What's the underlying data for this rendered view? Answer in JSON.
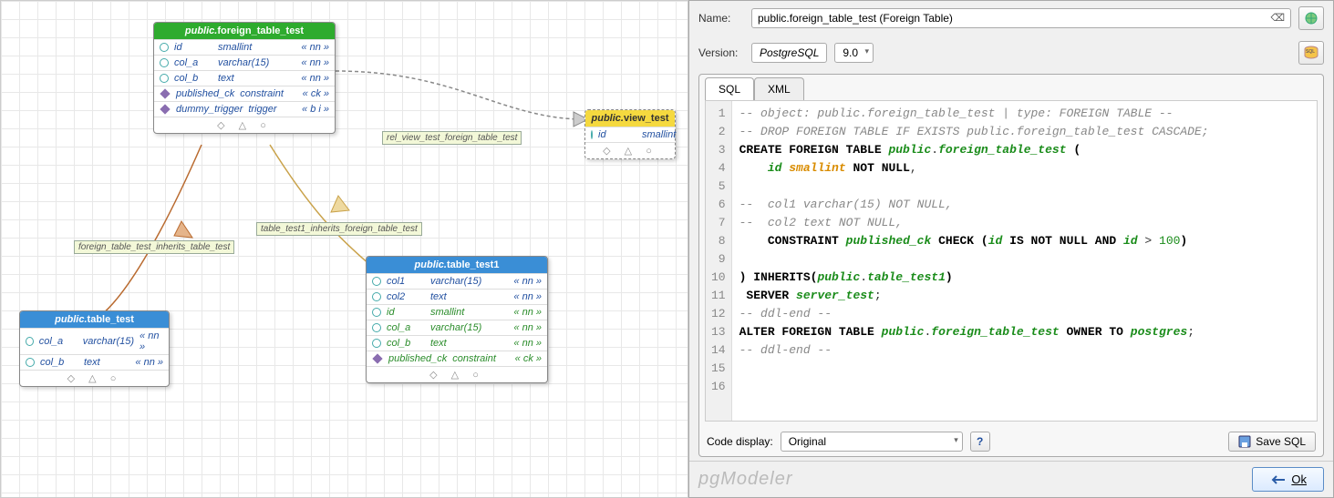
{
  "panel": {
    "name_label": "Name:",
    "name_value": "public.foreign_table_test (Foreign Table)",
    "version_label": "Version:",
    "version_engine": "PostgreSQL",
    "version_num": "9.0",
    "tabs": {
      "sql": "SQL",
      "xml": "XML"
    },
    "code_display_label": "Code display:",
    "code_display_value": "Original",
    "save_sql": "Save SQL",
    "brand": "pgModeler",
    "ok": "Ok"
  },
  "tables": {
    "foreign": {
      "title_schema": "public.",
      "title_name": "foreign_table_test",
      "rows": [
        {
          "k": "pk",
          "n": "id",
          "t": "smallint",
          "f": "« nn »"
        },
        {
          "k": "pk",
          "n": "col_a",
          "t": "varchar(15)",
          "f": "« nn »"
        },
        {
          "k": "pk",
          "n": "col_b",
          "t": "text",
          "f": "« nn »"
        },
        {
          "k": "dia",
          "n": "published_ck",
          "t": "constraint",
          "f": "« ck »"
        },
        {
          "k": "dia",
          "n": "dummy_trigger",
          "t": "trigger",
          "f": "« b i »"
        }
      ]
    },
    "view": {
      "title_schema": "public.",
      "title_name": "view_test",
      "rows": [
        {
          "k": "pk",
          "n": "id",
          "t": "smallint",
          "f": ""
        }
      ]
    },
    "test1": {
      "title_schema": "public.",
      "title_name": "table_test1",
      "rows": [
        {
          "k": "pk",
          "n": "col1",
          "t": "varchar(15)",
          "f": "« nn »"
        },
        {
          "k": "pk",
          "n": "col2",
          "t": "text",
          "f": "« nn »"
        },
        {
          "k": "pk",
          "n": "id",
          "t": "smallint",
          "f": "« nn »",
          "inh": true
        },
        {
          "k": "pk",
          "n": "col_a",
          "t": "varchar(15)",
          "f": "« nn »",
          "inh": true
        },
        {
          "k": "pk",
          "n": "col_b",
          "t": "text",
          "f": "« nn »",
          "inh": true
        },
        {
          "k": "dia",
          "n": "published_ck",
          "t": "constraint",
          "f": "« ck »",
          "inh": true
        }
      ]
    },
    "test": {
      "title_schema": "public.",
      "title_name": "table_test",
      "rows": [
        {
          "k": "pk",
          "n": "col_a",
          "t": "varchar(15)",
          "f": "« nn »"
        },
        {
          "k": "pk",
          "n": "col_b",
          "t": "text",
          "f": "« nn »"
        }
      ]
    }
  },
  "relations": {
    "r1": "rel_view_test_foreign_table_test",
    "r2": "table_test1_inherits_foreign_table_test",
    "r3": "foreign_table_test_inherits_table_test"
  },
  "sql_lines": [
    {
      "n": 1,
      "html": "<span class='cmt'>-- object: public.foreign_table_test | type: FOREIGN TABLE --</span>"
    },
    {
      "n": 2,
      "html": "<span class='cmt'>-- DROP FOREIGN TABLE IF EXISTS public.foreign_table_test CASCADE;</span>"
    },
    {
      "n": 3,
      "html": "<span class='kw'>CREATE FOREIGN TABLE</span> <span class='ident'>public</span>.<span class='ident'>foreign_table_test</span> <span class='kw'>(</span>"
    },
    {
      "n": 4,
      "html": "    <span class='ident'>id</span> <span class='ty'>smallint</span> <span class='kw'>NOT NULL</span>,"
    },
    {
      "n": 5,
      "html": " "
    },
    {
      "n": 6,
      "html": "<span class='cmt'>--  col1 varchar(15) NOT NULL,</span>"
    },
    {
      "n": 7,
      "html": "<span class='cmt'>--  col2 text NOT NULL,</span>"
    },
    {
      "n": 8,
      "html": "    <span class='kw'>CONSTRAINT</span> <span class='ident'>published_ck</span> <span class='kw'>CHECK</span> <span class='kw'>(</span><span class='ident'>id</span> <span class='kw'>IS NOT NULL AND</span> <span class='ident'>id</span> &gt; <span class='num'>100</span><span class='kw'>)</span>"
    },
    {
      "n": 9,
      "html": " "
    },
    {
      "n": 10,
      "html": "<span class='kw'>) INHERITS(</span><span class='ident'>public</span>.<span class='ident'>table_test1</span><span class='kw'>)</span>"
    },
    {
      "n": 11,
      "html": " <span class='kw'>SERVER</span> <span class='ident'>server_test</span>;"
    },
    {
      "n": 12,
      "html": "<span class='cmt'>-- ddl-end --</span>"
    },
    {
      "n": 13,
      "html": "<span class='kw'>ALTER FOREIGN TABLE</span> <span class='ident'>public</span>.<span class='ident'>foreign_table_test</span> <span class='kw'>OWNER TO</span> <span class='ident'>postgres</span>;"
    },
    {
      "n": 14,
      "html": "<span class='cmt'>-- ddl-end --</span>"
    },
    {
      "n": 15,
      "html": " "
    },
    {
      "n": 16,
      "html": " "
    }
  ]
}
